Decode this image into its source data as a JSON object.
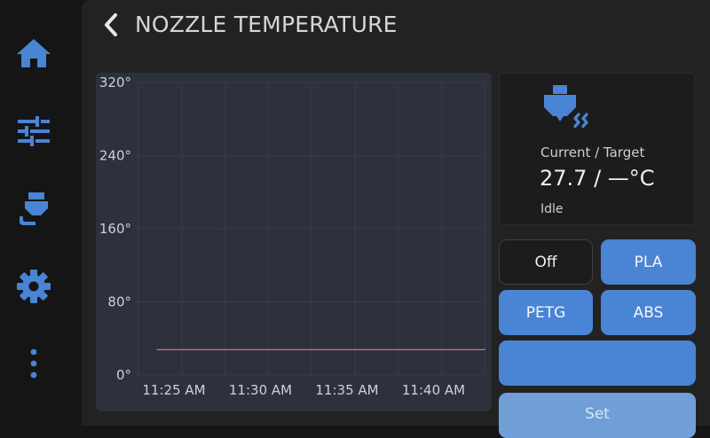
{
  "header": {
    "title": "NOZZLE TEMPERATURE"
  },
  "sidebar": {
    "items": [
      {
        "icon": "home-icon"
      },
      {
        "icon": "sliders-icon"
      },
      {
        "icon": "extruder-icon"
      },
      {
        "icon": "gear-icon"
      },
      {
        "icon": "more-vertical-icon"
      }
    ],
    "icon_color": "#4a84d4"
  },
  "temperature_panel": {
    "current_target_label": "Current / Target",
    "value_text": "27.7 / —°C",
    "status": "Idle",
    "icon": "nozzle-heat-icon"
  },
  "presets": {
    "off_label": "Off",
    "pla_label": "PLA",
    "petg_label": "PETG",
    "abs_label": "ABS",
    "custom_label": "",
    "set_label": "Set"
  },
  "colors": {
    "accent": "#4a84d4",
    "panel_bg": "#222222",
    "chart_bg": "#2c313c",
    "trace": "#e06c75"
  },
  "chart_data": {
    "type": "line",
    "title": "",
    "xlabel": "",
    "ylabel": "",
    "ylim": [
      0,
      320
    ],
    "y_ticks": [
      "320°",
      "240°",
      "160°",
      "80°",
      "0°"
    ],
    "y_tick_values": [
      320,
      240,
      160,
      80,
      0
    ],
    "x_ticks": [
      "11:25 AM",
      "11:30 AM",
      "11:35 AM",
      "11:40 AM"
    ],
    "grid": true,
    "series": [
      {
        "x": [
          "11:24 AM",
          "11:43 AM"
        ],
        "values": [
          27.7,
          27.7
        ]
      }
    ]
  }
}
